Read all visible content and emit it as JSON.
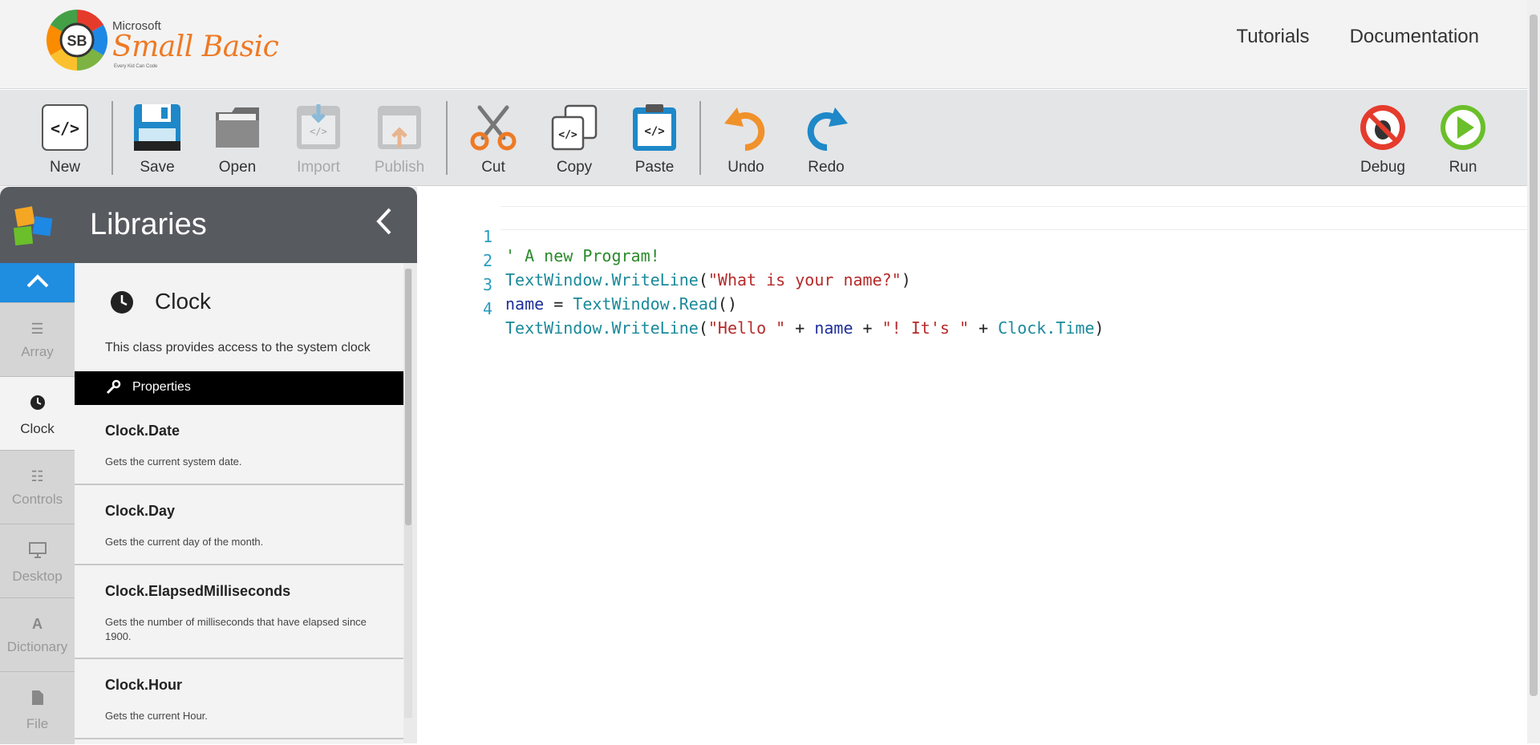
{
  "header": {
    "logo_ms": "Microsoft",
    "logo_name": "Small Basic",
    "logo_tagline": "Every Kid Can Code",
    "nav": [
      "Tutorials",
      "Documentation"
    ]
  },
  "toolbar": {
    "new": "New",
    "save": "Save",
    "open": "Open",
    "import": "Import",
    "publish": "Publish",
    "cut": "Cut",
    "copy": "Copy",
    "paste": "Paste",
    "undo": "Undo",
    "redo": "Redo",
    "debug": "Debug",
    "run": "Run"
  },
  "sidebar": {
    "title": "Libraries",
    "categories": [
      {
        "label": "Array",
        "icon": "list-icon"
      },
      {
        "label": "Clock",
        "icon": "clock-icon"
      },
      {
        "label": "Controls",
        "icon": "controls-icon"
      },
      {
        "label": "Desktop",
        "icon": "monitor-icon"
      },
      {
        "label": "Dictionary",
        "icon": "letter-a-icon"
      },
      {
        "label": "File",
        "icon": "file-icon"
      }
    ],
    "active_category": "Clock",
    "class_name": "Clock",
    "class_description": "This class provides access to the system clock",
    "properties_label": "Properties",
    "properties": [
      {
        "name": "Clock.Date",
        "desc": "Gets the current system date."
      },
      {
        "name": "Clock.Day",
        "desc": "Gets the current day of the month."
      },
      {
        "name": "Clock.ElapsedMilliseconds",
        "desc": "Gets the number of milliseconds that have elapsed since 1900."
      },
      {
        "name": "Clock.Hour",
        "desc": "Gets the current Hour."
      }
    ]
  },
  "editor": {
    "line_numbers": [
      "1",
      "2",
      "3",
      "4"
    ],
    "line1": {
      "comment": "' A new Program!"
    },
    "line2": {
      "obj": "TextWindow.WriteLine",
      "open": "(",
      "str": "\"What is your name?\"",
      "close": ")"
    },
    "line3": {
      "var": "name",
      "eq": " = ",
      "obj": "TextWindow.Read",
      "paren": "()"
    },
    "line4": {
      "obj": "TextWindow.WriteLine",
      "open": "(",
      "str1": "\"Hello \"",
      "plus1": " + ",
      "var": "name",
      "plus2": " + ",
      "str2": "\"! It's \"",
      "plus3": " + ",
      "obj2": "Clock.Time",
      "close": ")"
    }
  },
  "colors": {
    "accent_blue": "#1f8de0",
    "header_bg": "#f3f3f3",
    "sidebar_head": "#575a5f",
    "logo_orange": "#ee7a24"
  }
}
